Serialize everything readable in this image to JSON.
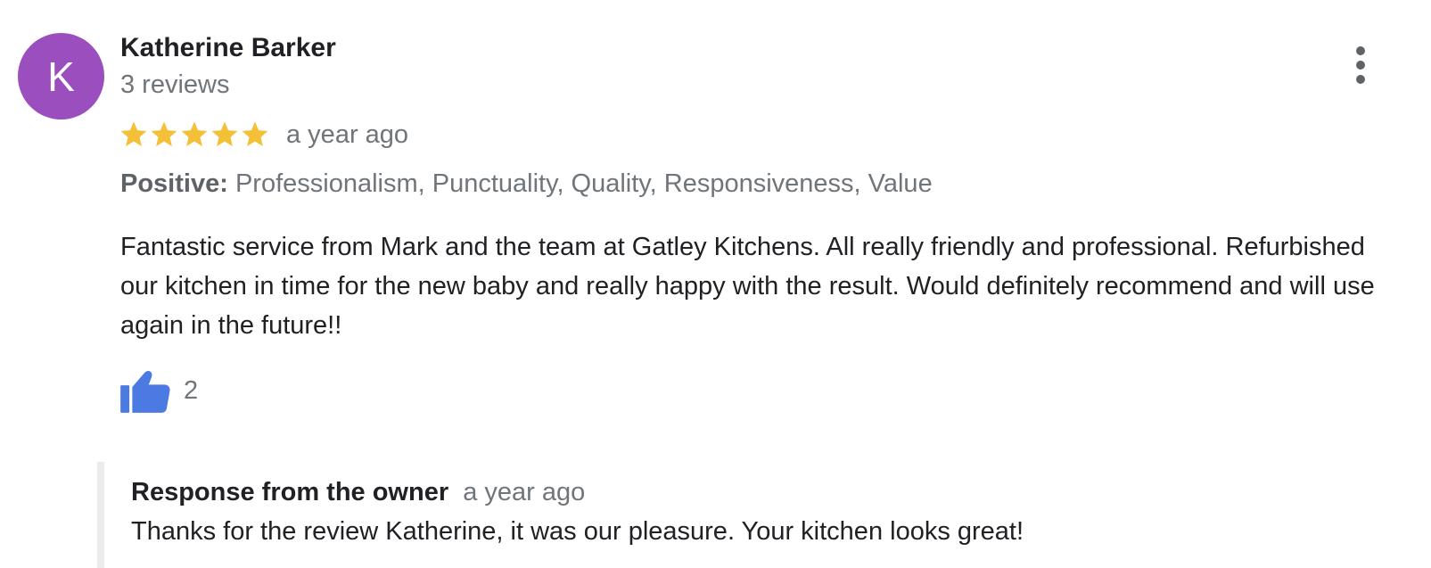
{
  "colors": {
    "avatar_background": "#9b4fbf",
    "star": "#f4c037",
    "star_empty": "#dadce0",
    "like_icon": "#4a7ae2"
  },
  "review": {
    "avatar_letter": "K",
    "reviewer_name": "Katherine Barker",
    "review_count": "3 reviews",
    "rating": 5,
    "rating_max": 5,
    "date": "a year ago",
    "positive_label": "Positive:",
    "positive_values": "Professionalism, Punctuality, Quality, Responsiveness, Value",
    "text": "Fantastic service from Mark and the team at Gatley Kitchens. All really friendly and professional. Refurbished our kitchen in time for the new baby and really happy with the result. Would definitely recommend and will use again in the future!!",
    "like_count": "2",
    "icons": {
      "more": "more-vertical-icon",
      "like": "thumbs-up-icon",
      "star": "star-icon"
    }
  },
  "owner_response": {
    "title": "Response from the owner",
    "date": "a year ago",
    "text": "Thanks for the review Katherine, it was our pleasure. Your kitchen looks great!"
  }
}
